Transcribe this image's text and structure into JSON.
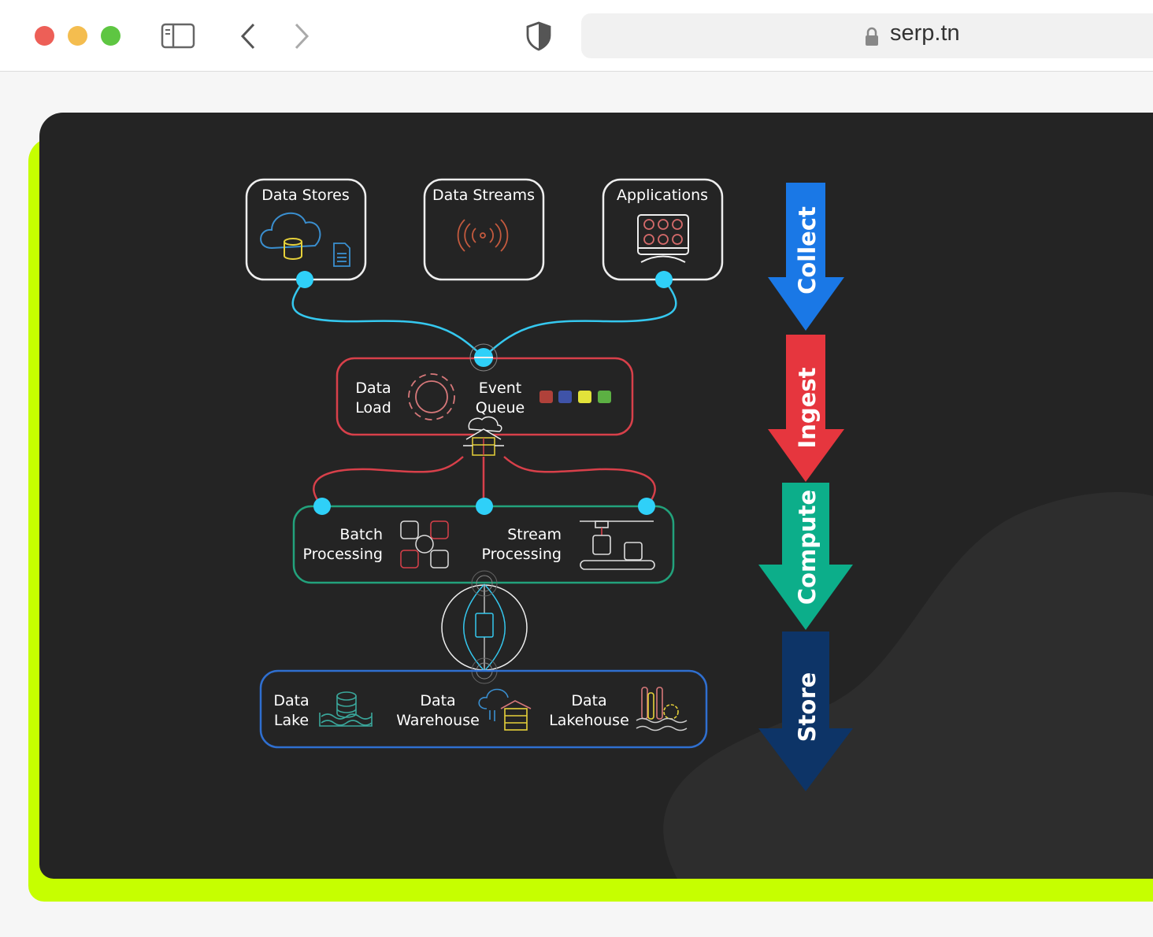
{
  "browser": {
    "url": "serp.tn",
    "traffic_lights": [
      "#ed5f57",
      "#f4bd4f",
      "#5ec642"
    ],
    "icons": [
      "sidebar-icon",
      "back-icon",
      "forward-icon",
      "shield-icon",
      "lock-icon"
    ]
  },
  "diagram": {
    "sources": [
      {
        "label": "Data Stores",
        "icon": "cloud-database-icon"
      },
      {
        "label": "Data Streams",
        "icon": "broadcast-icon"
      },
      {
        "label": "Applications",
        "icon": "app-grid-icon"
      }
    ],
    "ingest": {
      "data_load": [
        "Data",
        "Load"
      ],
      "event_queue": [
        "Event",
        "Queue"
      ],
      "queue_colors": [
        "#b0413a",
        "#3f53a8",
        "#e3e33a",
        "#5cb043"
      ]
    },
    "compute": {
      "batch": [
        "Batch",
        "Processing"
      ],
      "stream": [
        "Stream",
        "Processing"
      ]
    },
    "store": {
      "lake": [
        "Data",
        "Lake"
      ],
      "warehouse": [
        "Data",
        "Warehouse"
      ],
      "lakehouse": [
        "Data",
        "Lakehouse"
      ]
    },
    "stages": [
      {
        "label": "Collect",
        "color": "#1a78e6"
      },
      {
        "label": "Ingest",
        "color": "#e6363e"
      },
      {
        "label": "Compute",
        "color": "#0cae8a"
      },
      {
        "label": "Store",
        "color": "#0d3467"
      }
    ],
    "colors": {
      "connector": "#35c8ef",
      "ingest_border": "#d8404a",
      "compute_border": "#22a27c",
      "store_border": "#2f6fd0",
      "frame": "#c6ff00",
      "background": "#242424"
    }
  }
}
